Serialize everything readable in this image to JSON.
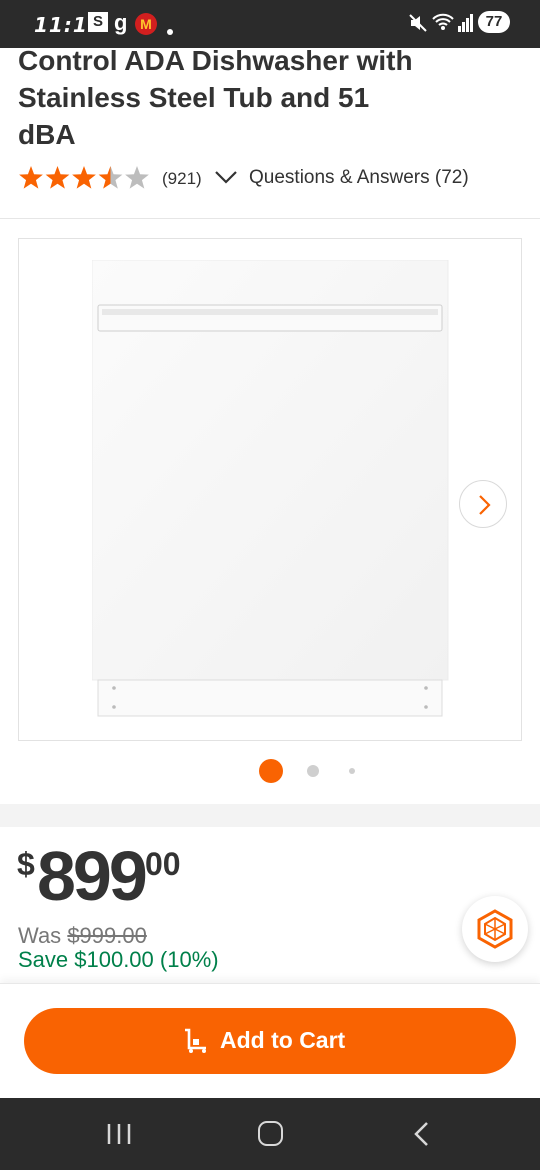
{
  "status_bar": {
    "time": "11:12",
    "battery": "77",
    "app_icons": [
      "samsung-s-icon",
      "google-g-icon",
      "mcdonalds-icon"
    ],
    "system_icons": [
      "mute-icon",
      "wifi-icon",
      "signal-icon",
      "battery-icon"
    ]
  },
  "product": {
    "title_lines": [
      "Control ADA Dishwasher with",
      "Stainless Steel Tub and 51",
      "dBA"
    ],
    "rating": 3.5,
    "review_count": "(921)",
    "qa_label": "Questions & Answers (72)"
  },
  "gallery": {
    "image_icon": "dishwasher-image",
    "current_index": 1,
    "total": 3,
    "next_icon": "chevron-right-icon"
  },
  "price": {
    "currency": "$",
    "dollars": "899",
    "cents": "00",
    "was_label": "Was",
    "was_amount": "$999.00",
    "save_text": "Save $100.00 (10%)"
  },
  "cta": {
    "add_to_cart": "Add to Cart",
    "icon": "cart-icon"
  },
  "fab": {
    "icon": "hexagon-assistant-icon"
  },
  "nav_bar": {
    "icons": [
      "recents-icon",
      "home-icon",
      "back-icon"
    ]
  },
  "colors": {
    "brand_orange": "#f96302",
    "save_green": "#00804a",
    "star_orange": "#f96302",
    "star_gray": "#bdbdbd",
    "status_bar_bg": "#2b2b2b"
  }
}
